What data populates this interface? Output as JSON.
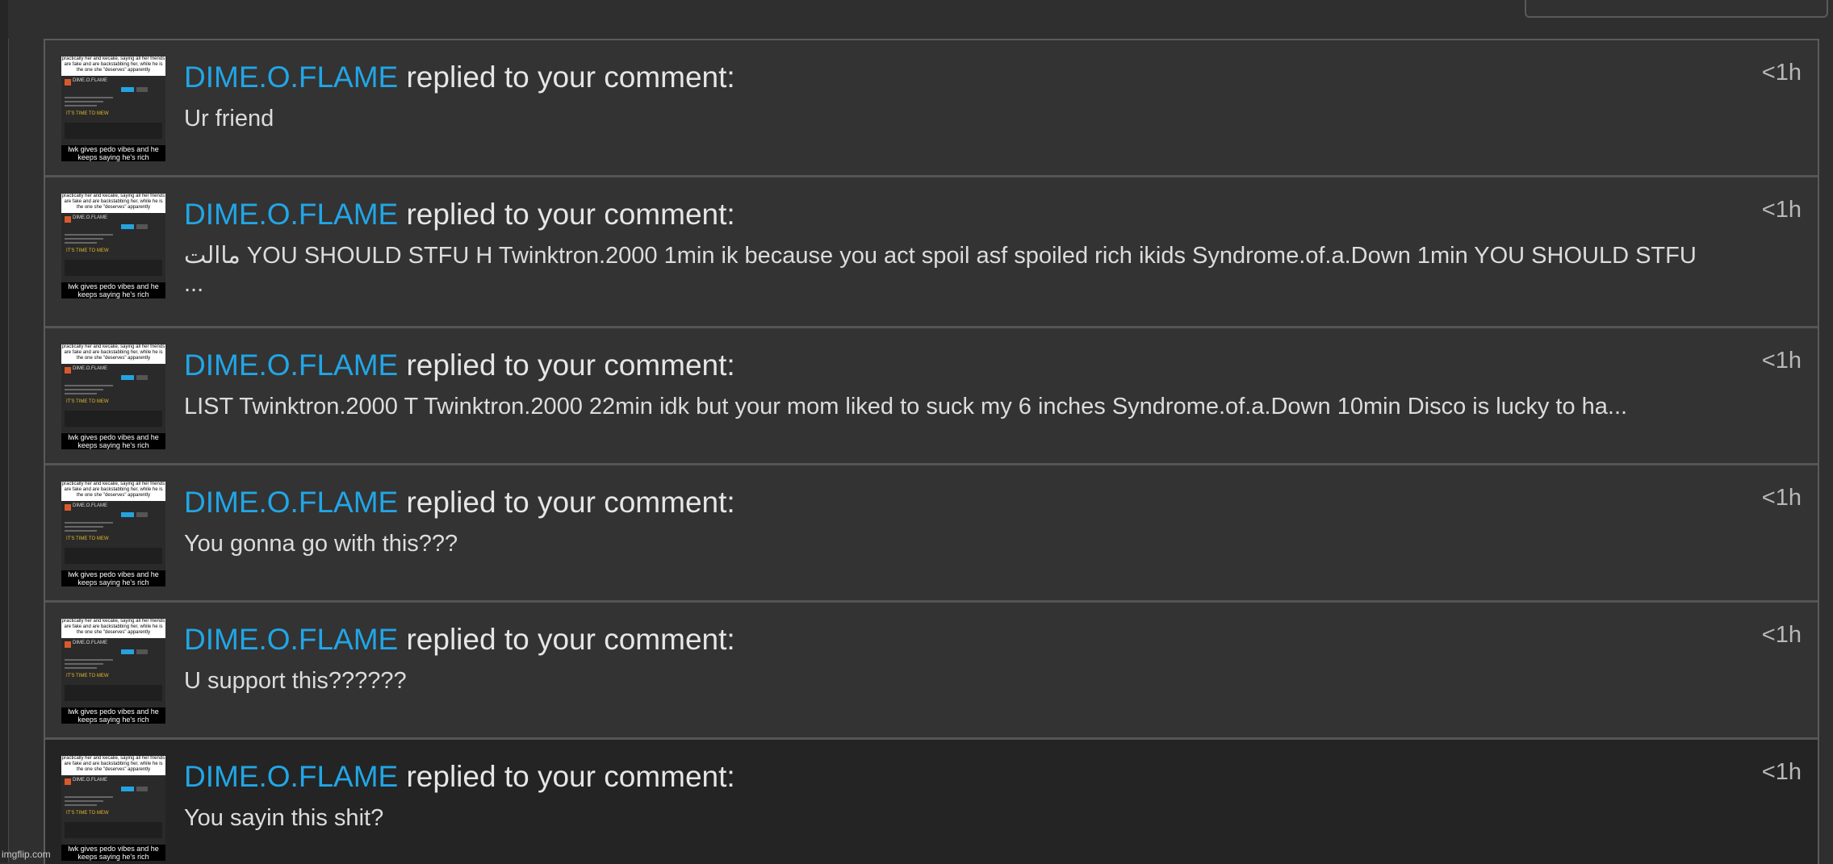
{
  "notifications": [
    {
      "username": "DIME.O.FLAME",
      "action": " replied to your comment:",
      "message": "Ur friend",
      "time": "<1h"
    },
    {
      "username": "DIME.O.FLAME",
      "action": " replied to your comment:",
      "message": "ماالت YOU SHOULD STFU H Twinktron.2000 1min ik because you act spoil asf spoiled rich ikids Syndrome.of.a.Down 1min YOU SHOULD STFU ...",
      "time": "<1h"
    },
    {
      "username": "DIME.O.FLAME",
      "action": " replied to your comment:",
      "message": "LIST Twinktron.2000 T Twinktron.2000 22min idk but your mom liked to suck my 6 inches Syndrome.of.a.Down 10min Disco is lucky to ha...",
      "time": "<1h"
    },
    {
      "username": "DIME.O.FLAME",
      "action": " replied to your comment:",
      "message": "You gonna go with this???",
      "time": "<1h"
    },
    {
      "username": "DIME.O.FLAME",
      "action": " replied to your comment:",
      "message": "U support this??????",
      "time": "<1h"
    },
    {
      "username": "DIME.O.FLAME",
      "action": " replied to your comment:",
      "message": "You sayin this shit?",
      "time": "<1h"
    }
  ],
  "thumbnail": {
    "top_caption": "practically her and kecalie, saying all her friends are fake and are backstabbing her, while he is the one she \"deserves\" apparently",
    "profile_name": "DIME.O.FLAME",
    "banner": "IT'S TIME TO MEW",
    "bottom_caption": "lwk gives pedo vibes and he keeps saying he's rich"
  },
  "watermark": "imgflip.com"
}
